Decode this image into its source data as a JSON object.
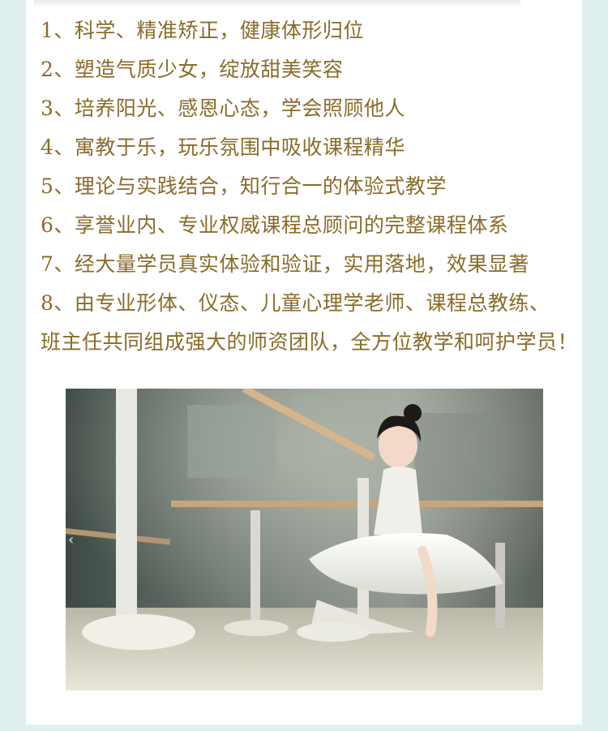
{
  "features": [
    "1、科学、精准矫正，健康体形归位",
    "2、塑造气质少女，绽放甜美笑容",
    "3、培养阳光、感恩心态，学会照顾他人",
    "4、寓教于乐，玩乐氛围中吸收课程精华",
    "5、理论与实践结合，知行合一的体验式教学",
    "6、享誉业内、专业权威课程总顾问的完整课程体系",
    "7、经大量学员真实体验和验证，实用落地，效果显著",
    "8、由专业形体、仪态、儿童心理学老师、课程总教练、",
    "班主任共同组成强大的师资团队，全方位教学和呵护学员！"
  ],
  "carousel": {
    "prev_glyph": "‹"
  },
  "colors": {
    "text": "#8a6b2a",
    "background": "#dff0ef",
    "card": "#ffffff"
  }
}
